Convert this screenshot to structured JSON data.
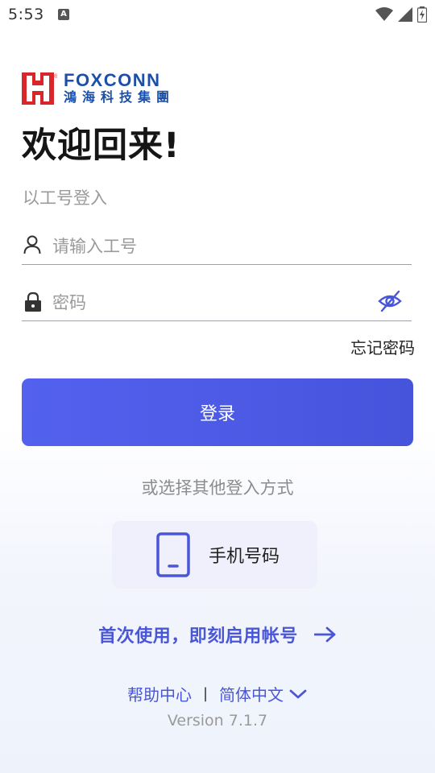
{
  "status_bar": {
    "time": "5:53",
    "notification_icon": "A"
  },
  "logo": {
    "en": "FOXCONN",
    "zh": "鴻海科技集團",
    "brand_color": "#1b4fa8",
    "accent_color": "#d8262b"
  },
  "header": {
    "welcome": "欢迎回来!",
    "subtitle": "以工号登入"
  },
  "form": {
    "employee_id": {
      "placeholder": "请输入工号",
      "value": "",
      "icon": "person-icon"
    },
    "password": {
      "placeholder": "密码",
      "value": "",
      "icon": "lock-icon",
      "toggle_icon": "eye-off-icon"
    },
    "forgot_password": "忘记密码",
    "login_button": "登录"
  },
  "alternatives": {
    "label": "或选择其他登入方式",
    "phone_option": {
      "label": "手机号码",
      "icon": "phone-icon"
    }
  },
  "first_use": {
    "label": "首次使用，即刻启用帐号",
    "icon": "arrow-right-icon"
  },
  "footer": {
    "help": "帮助中心",
    "separator": "|",
    "language": "简体中文",
    "language_icon": "chevron-down-icon",
    "version": "Version 7.1.7"
  },
  "colors": {
    "primary": "#4e5ce8",
    "link": "#4a56d8"
  }
}
